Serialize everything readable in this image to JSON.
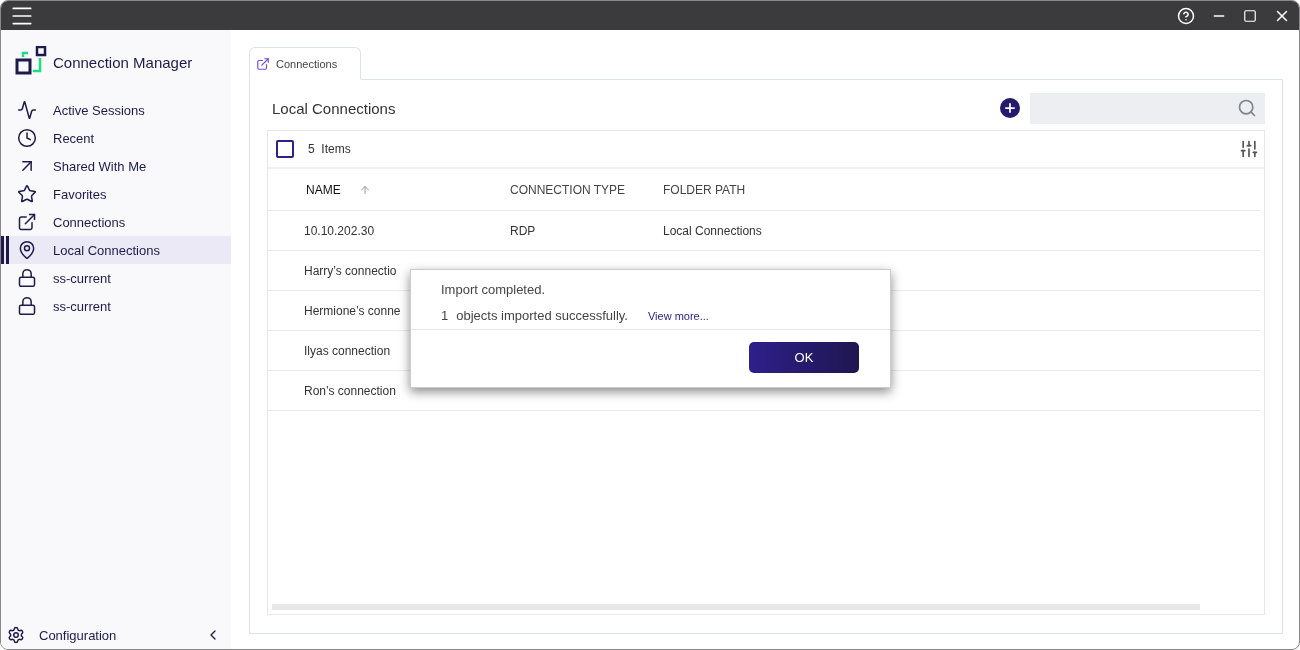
{
  "app": {
    "title": "Connection Manager"
  },
  "sidebar": {
    "items": [
      {
        "label": "Active Sessions",
        "selected": false
      },
      {
        "label": "Recent",
        "selected": false
      },
      {
        "label": "Shared With Me",
        "selected": false
      },
      {
        "label": "Favorites",
        "selected": false
      },
      {
        "label": "Connections",
        "selected": false
      },
      {
        "label": "Local Connections",
        "selected": true
      },
      {
        "label": "ss-current",
        "selected": false
      },
      {
        "label": "ss-current",
        "selected": false
      }
    ],
    "footer": {
      "label": "Configuration"
    }
  },
  "tabs": [
    {
      "label": "Connections",
      "selected": true
    }
  ],
  "panel": {
    "title": "Local Connections",
    "count": "5",
    "count_label": "Items",
    "select_all": {
      "checked": false
    }
  },
  "table": {
    "columns": [
      {
        "label": "NAME",
        "sorted": true
      },
      {
        "label": "CONNECTION TYPE",
        "sorted": false
      },
      {
        "label": "FOLDER PATH",
        "sorted": false
      }
    ],
    "rows": [
      {
        "name": "10.10.202.30",
        "type": "RDP",
        "folder": "Local Connections"
      },
      {
        "name": "Harry’s connectio"
      },
      {
        "name": "Hermione’s conne"
      },
      {
        "name": "Ilyas connection"
      },
      {
        "name": "Ron’s connection"
      }
    ]
  },
  "dialog": {
    "message": "Import completed.",
    "count": "1",
    "detail": "objects imported successfully.",
    "link": "View more...",
    "button": "OK"
  }
}
